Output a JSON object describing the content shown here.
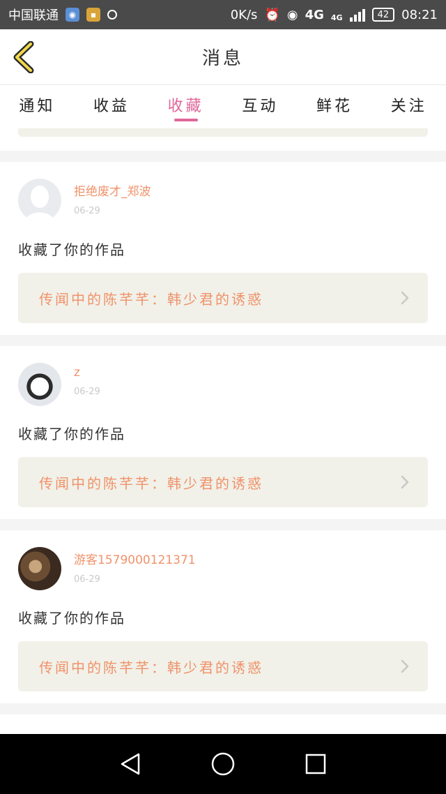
{
  "status_bar": {
    "carrier": "中国联通",
    "speed": "0K/s",
    "network": "4G",
    "network_small": "4G",
    "battery": "42",
    "time": "08:21"
  },
  "header": {
    "title": "消息",
    "back_icon": "chevron-left-icon",
    "accent_color": "#e0679a"
  },
  "tabs": [
    {
      "label": "通知",
      "active": false
    },
    {
      "label": "收益",
      "active": false
    },
    {
      "label": "收藏",
      "active": true
    },
    {
      "label": "互动",
      "active": false
    },
    {
      "label": "鲜花",
      "active": false
    },
    {
      "label": "关注",
      "active": false
    }
  ],
  "messages": [
    {
      "username": "拒绝废才_郑波",
      "date": "06-29",
      "action": "收藏了你的作品",
      "work_title": "传闻中的陈芊芊：韩少君的诱惑"
    },
    {
      "username": "z",
      "date": "06-29",
      "action": "收藏了你的作品",
      "work_title": "传闻中的陈芊芊：韩少君的诱惑"
    },
    {
      "username": "游客1579000121371",
      "date": "06-29",
      "action": "收藏了你的作品",
      "work_title": "传闻中的陈芊芊：韩少君的诱惑"
    }
  ],
  "nav_bar": {
    "back_icon": "triangle-back-icon",
    "home_icon": "circle-home-icon",
    "recents_icon": "square-recents-icon"
  }
}
